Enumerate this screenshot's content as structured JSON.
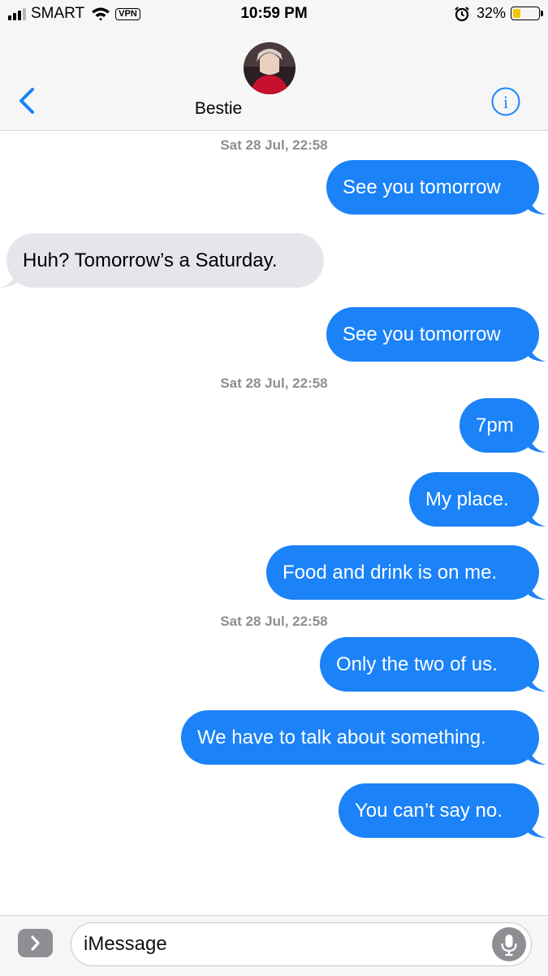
{
  "status_bar": {
    "carrier": "SMART",
    "vpn": "VPN",
    "time": "10:59 PM",
    "battery_percent": "32%",
    "battery_level": 0.32,
    "icons": [
      "signal-icon",
      "wifi-icon",
      "alarm-icon",
      "battery-icon"
    ]
  },
  "header": {
    "contact_name": "Bestie",
    "back_icon": "chevron-left-icon",
    "info_icon": "info-icon",
    "accent_color": "#1b82f7"
  },
  "messages": [
    {
      "type": "timestamp",
      "text": "Sat 28 Jul, 22:58"
    },
    {
      "type": "outgoing",
      "text": "See you tomorrow"
    },
    {
      "type": "incoming",
      "text": "Huh? Tomorrow’s a Saturday."
    },
    {
      "type": "outgoing",
      "text": "See you tomorrow"
    },
    {
      "type": "timestamp",
      "text": "Sat 28 Jul, 22:58"
    },
    {
      "type": "outgoing",
      "text": "7pm"
    },
    {
      "type": "outgoing",
      "text": "My place."
    },
    {
      "type": "outgoing",
      "text": "Food and drink is on me."
    },
    {
      "type": "timestamp",
      "text": "Sat 28 Jul, 22:58"
    },
    {
      "type": "outgoing",
      "text": "Only the two of us."
    },
    {
      "type": "outgoing",
      "text": "We have to talk about something."
    },
    {
      "type": "outgoing",
      "text": "You can’t say no."
    }
  ],
  "colors": {
    "outgoing_bubble": "#1b82f7",
    "incoming_bubble": "#e6e5eb",
    "timestamp_text": "#8e8e93"
  },
  "composer": {
    "placeholder": "iMessage",
    "apps_icon": "chevron-right-icon",
    "mic_icon": "microphone-icon"
  }
}
